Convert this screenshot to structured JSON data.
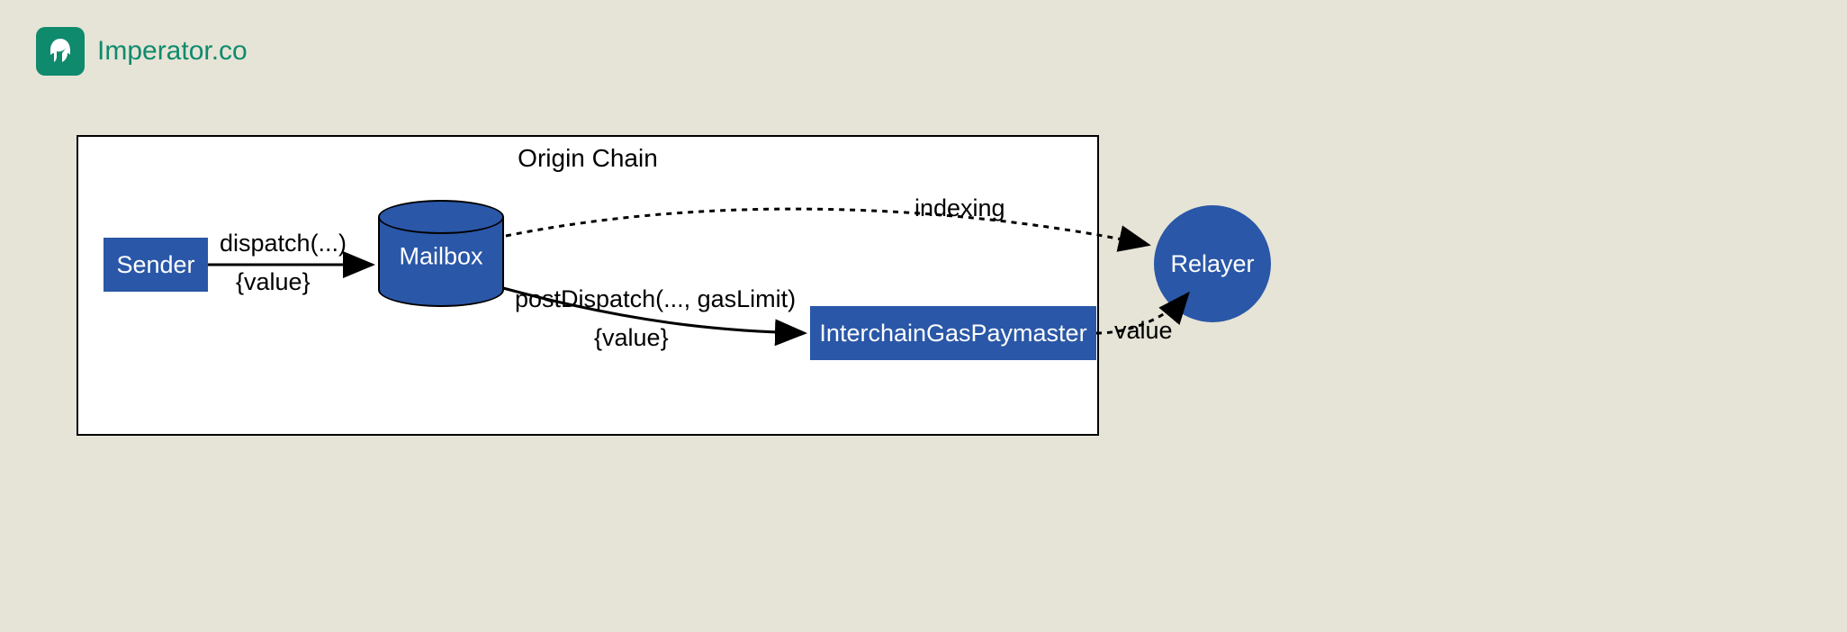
{
  "brand": {
    "name": "Imperator.co"
  },
  "diagram": {
    "container_title": "Origin Chain",
    "nodes": {
      "sender": "Sender",
      "mailbox": "Mailbox",
      "igp": "InterchainGasPaymaster",
      "relayer": "Relayer"
    },
    "edges": {
      "dispatch": {
        "label": "dispatch(...)",
        "note": "{value}"
      },
      "postDispatch": {
        "label": "postDispatch(..., gasLimit)",
        "note": "{value}"
      },
      "indexing": {
        "label": "indexing"
      },
      "value": {
        "label": "value"
      }
    },
    "colors": {
      "node_fill": "#2a57a7",
      "brand": "#0f8a6d",
      "background": "#e6e4d6"
    }
  }
}
